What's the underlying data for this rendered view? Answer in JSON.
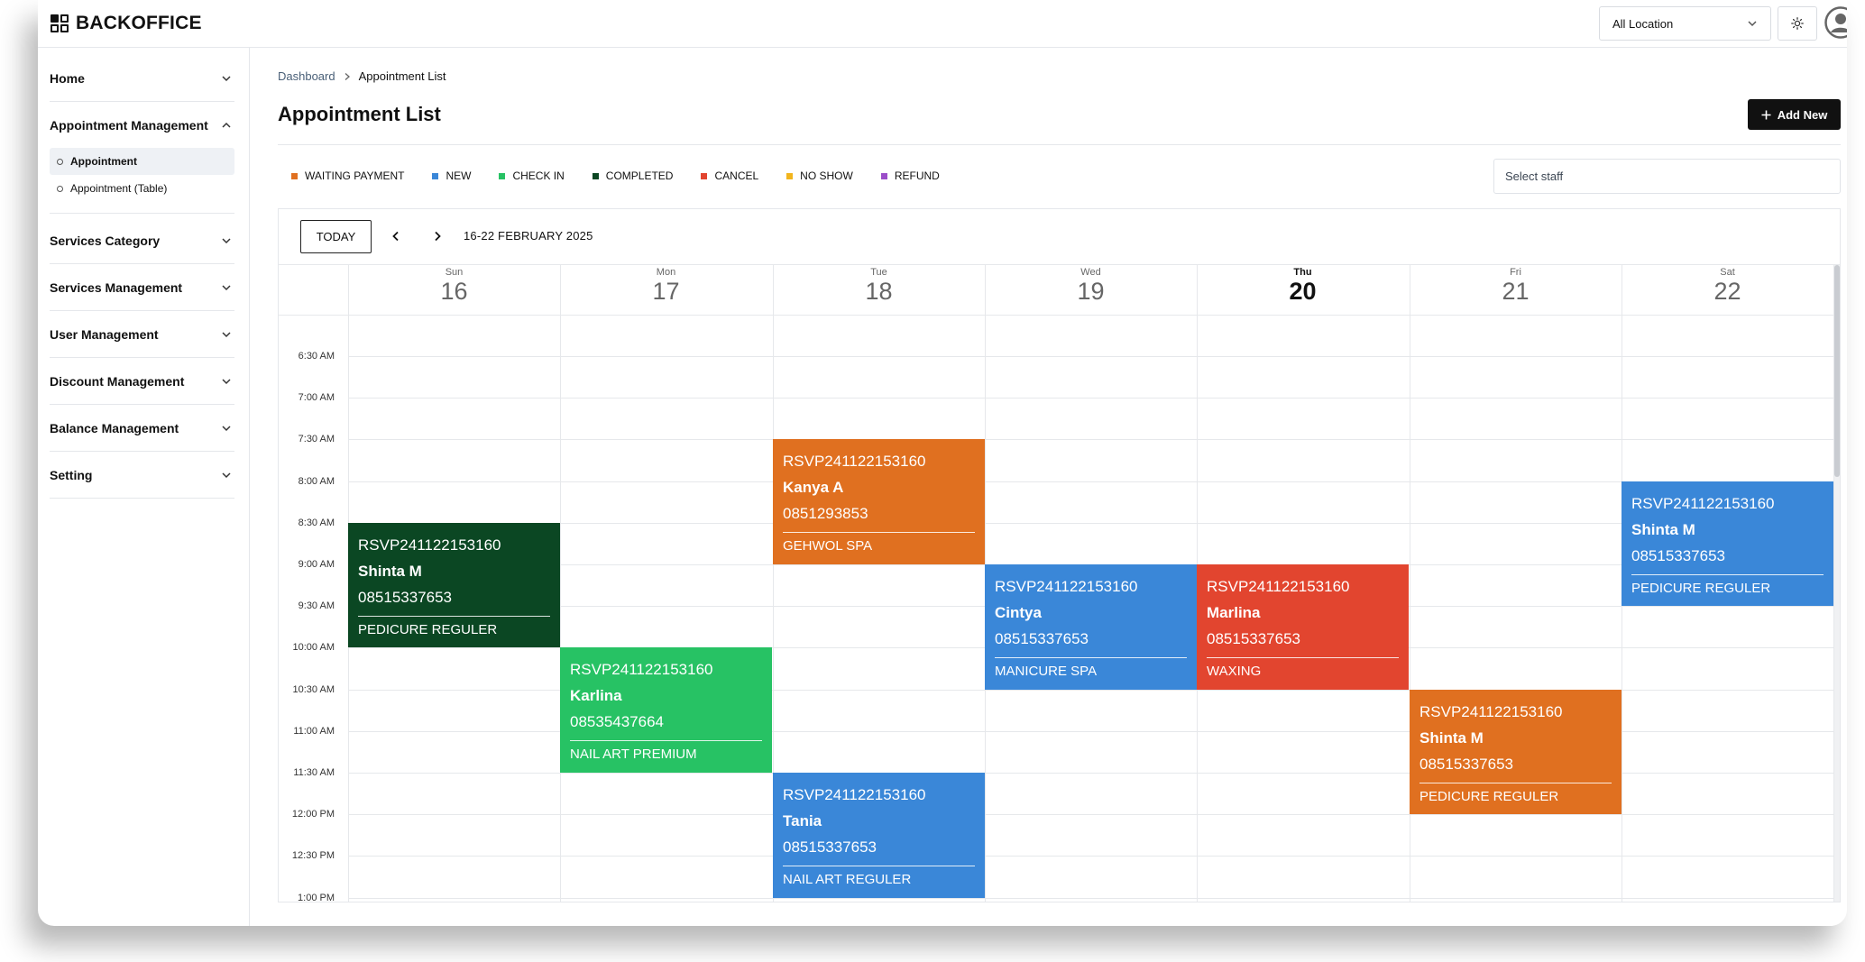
{
  "app": {
    "brand": "BACKOFFICE"
  },
  "topbar": {
    "location_select": "All Location"
  },
  "sidebar": {
    "groups": [
      {
        "label": "Home",
        "expanded": false
      },
      {
        "label": "Appointment Management",
        "expanded": true,
        "items": [
          {
            "label": "Appointment",
            "active": true
          },
          {
            "label": "Appointment (Table)",
            "active": false
          }
        ]
      },
      {
        "label": "Services Category",
        "expanded": false
      },
      {
        "label": "Services Management",
        "expanded": false
      },
      {
        "label": "User Management",
        "expanded": false
      },
      {
        "label": "Discount Management",
        "expanded": false
      },
      {
        "label": "Balance Management",
        "expanded": false
      },
      {
        "label": "Setting",
        "expanded": false
      }
    ]
  },
  "breadcrumb": {
    "parent": "Dashboard",
    "current": "Appointment List"
  },
  "page": {
    "title": "Appointment List",
    "add_button": "Add New"
  },
  "legend": [
    {
      "label": "WAITING PAYMENT",
      "color": "#e07020"
    },
    {
      "label": "NEW",
      "color": "#3a87d8"
    },
    {
      "label": "CHECK IN",
      "color": "#27c264"
    },
    {
      "label": "COMPLETED",
      "color": "#0b4723"
    },
    {
      "label": "CANCEL",
      "color": "#e2452f"
    },
    {
      "label": "NO SHOW",
      "color": "#f2b51d"
    },
    {
      "label": "REFUND",
      "color": "#9b4ec9"
    }
  ],
  "staff_select": {
    "placeholder": "Select staff"
  },
  "calendar": {
    "today_label": "TODAY",
    "range": "16-22 FEBRUARY 2025",
    "days": [
      {
        "name": "Sun",
        "num": "16",
        "today": false
      },
      {
        "name": "Mon",
        "num": "17",
        "today": false
      },
      {
        "name": "Tue",
        "num": "18",
        "today": false
      },
      {
        "name": "Wed",
        "num": "19",
        "today": false
      },
      {
        "name": "Thu",
        "num": "20",
        "today": true
      },
      {
        "name": "Fri",
        "num": "21",
        "today": false
      },
      {
        "name": "Sat",
        "num": "22",
        "today": false
      }
    ],
    "times": [
      "6:30 AM",
      "7:00 AM",
      "7:30 AM",
      "8:00 AM",
      "8:30 AM",
      "9:00 AM",
      "9:30 AM",
      "10:00 AM",
      "10:30 AM",
      "11:00 AM",
      "11:30 AM",
      "12:00 PM",
      "12:30 PM",
      "1:00 PM"
    ],
    "events": [
      {
        "day": 0,
        "start": "8:30 AM",
        "end": "10:00 AM",
        "code": "RSVP241122153160",
        "name": "Shinta M",
        "phone": "08515337653",
        "service": "PEDICURE REGULER",
        "status": "COMPLETED",
        "color": "#0b4723"
      },
      {
        "day": 1,
        "start": "10:00 AM",
        "end": "11:30 AM",
        "code": "RSVP241122153160",
        "name": "Karlina",
        "phone": "08535437664",
        "service": "NAIL ART PREMIUM",
        "status": "CHECK IN",
        "color": "#27c264"
      },
      {
        "day": 2,
        "start": "7:30 AM",
        "end": "9:00 AM",
        "code": "RSVP241122153160",
        "name": "Kanya A",
        "phone": "0851293853",
        "service": "GEHWOL SPA",
        "status": "WAITING PAYMENT",
        "color": "#e07020"
      },
      {
        "day": 2,
        "start": "11:30 AM",
        "end": "1:00 PM",
        "code": "RSVP241122153160",
        "name": "Tania",
        "phone": "08515337653",
        "service": "NAIL ART REGULER",
        "status": "NEW",
        "color": "#3a87d8"
      },
      {
        "day": 3,
        "start": "9:00 AM",
        "end": "10:30 AM",
        "code": "RSVP241122153160",
        "name": "Cintya",
        "phone": "08515337653",
        "service": "MANICURE SPA",
        "status": "NEW",
        "color": "#3a87d8"
      },
      {
        "day": 4,
        "start": "9:00 AM",
        "end": "10:30 AM",
        "code": "RSVP241122153160",
        "name": "Marlina",
        "phone": "08515337653",
        "service": "WAXING",
        "status": "CANCEL",
        "color": "#e2452f"
      },
      {
        "day": 5,
        "start": "10:30 AM",
        "end": "12:00 PM",
        "code": "RSVP241122153160",
        "name": "Shinta M",
        "phone": "08515337653",
        "service": "PEDICURE REGULER",
        "status": "WAITING PAYMENT",
        "color": "#e07020"
      },
      {
        "day": 6,
        "start": "8:00 AM",
        "end": "9:30 AM",
        "code": "RSVP241122153160",
        "name": "Shinta M",
        "phone": "08515337653",
        "service": "PEDICURE REGULER",
        "status": "NEW",
        "color": "#3a87d8"
      }
    ]
  }
}
